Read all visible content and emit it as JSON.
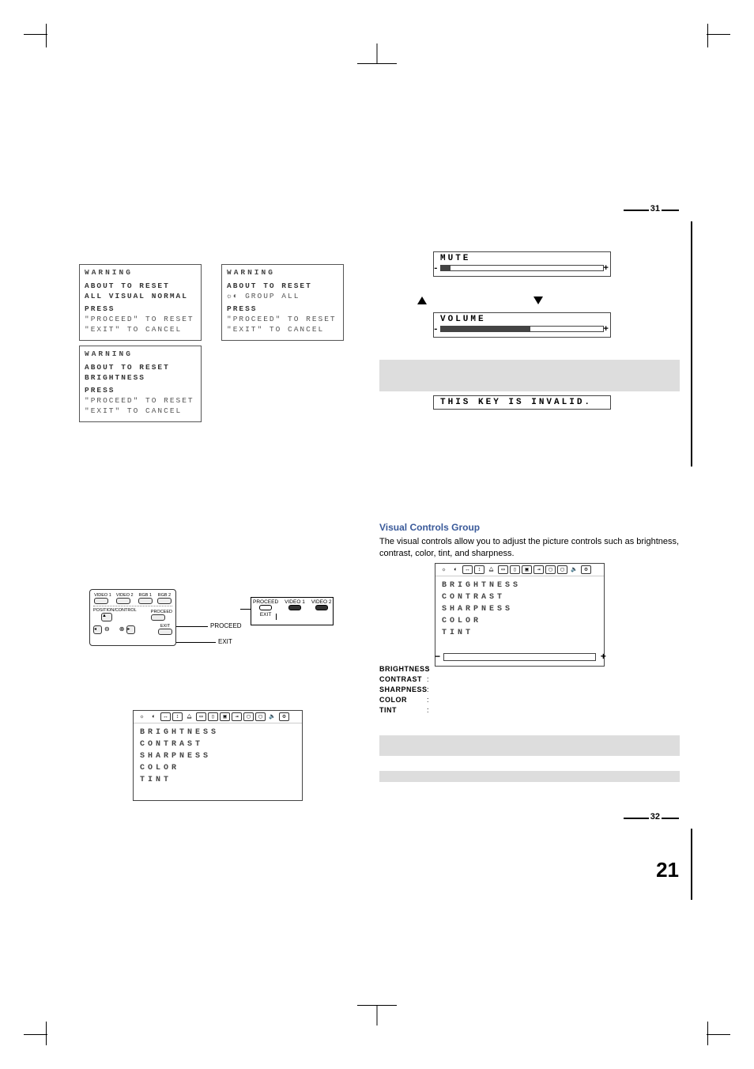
{
  "page_numbers": {
    "top": "31",
    "bottom": "32",
    "folio": "21"
  },
  "warning_boxes": {
    "box1": {
      "title": "WARNING",
      "l1": "ABOUT TO RESET",
      "l2": "ALL VISUAL NORMAL",
      "l3": "PRESS",
      "l4": "\"PROCEED\" TO RESET",
      "l5": "\"EXIT\" TO CANCEL"
    },
    "box2": {
      "title": "WARNING",
      "l1": "ABOUT TO RESET",
      "l2": "BRIGHTNESS",
      "l3": "PRESS",
      "l4": "\"PROCEED\" TO RESET",
      "l5": "\"EXIT\" TO CANCEL"
    },
    "box3": {
      "title": "WARNING",
      "l1": "ABOUT TO RESET",
      "l2": "☼◐ GROUP ALL",
      "l3": "PRESS",
      "l4": "\"PROCEED\" TO RESET",
      "l5": "\"EXIT\" TO CANCEL"
    }
  },
  "mute": {
    "label": "MUTE"
  },
  "volume": {
    "label": "VOLUME"
  },
  "invalid": {
    "text": "THIS KEY IS INVALID."
  },
  "visual_controls": {
    "title": "Visual Controls Group",
    "desc": "The visual controls allow you to adjust the picture controls such as brightness, contrast, color, tint, and sharpness."
  },
  "menu": {
    "i1": "BRIGHTNESS",
    "i2": "CONTRAST",
    "i3": "SHARPNESS",
    "i4": "COLOR",
    "i5": "TINT"
  },
  "defs": {
    "r1": "BRIGHTNESS",
    "r2": "CONTRAST",
    "r3": "SHARPNESS",
    "r4": "COLOR",
    "r5": "TINT"
  },
  "remote": {
    "b1": "VIDEO 1",
    "b2": "VIDEO 2",
    "b3": "RGB 1",
    "b4": "RGB 2",
    "row2": "POSITION/CONTROL",
    "proceed": "PROCEED",
    "exit": "EXIT",
    "label_proceed": "PROCEED",
    "label_exit": "EXIT"
  },
  "callout": {
    "c1": "PROCEED",
    "c2": "EXIT",
    "c3": "VIDEO 1",
    "c4": "VIDEO 2"
  }
}
